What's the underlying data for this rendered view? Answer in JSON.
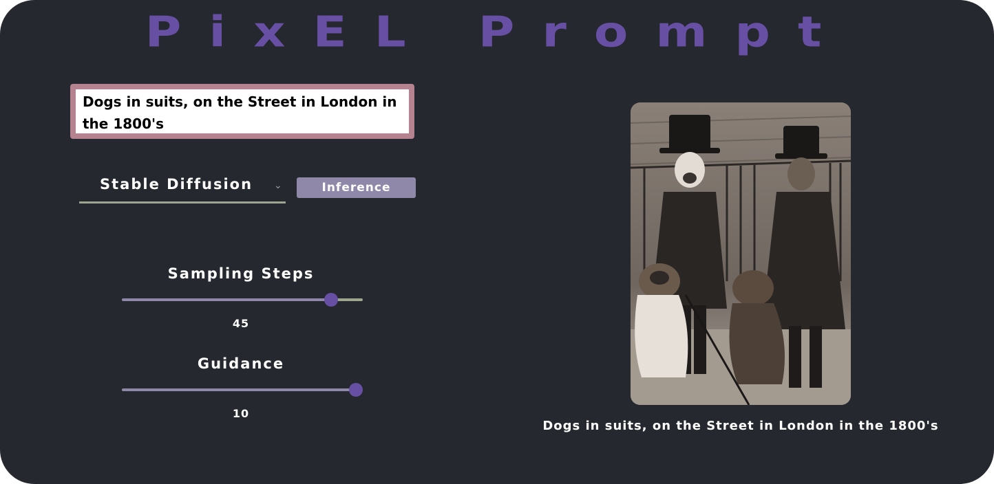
{
  "app": {
    "title": "PixEL Prompt"
  },
  "prompt": {
    "value": "Dogs in suits, on the Street in London in the 1800's"
  },
  "model_select": {
    "selected": "Stable Diffusion"
  },
  "inference_button": {
    "label": "Inference"
  },
  "sliders": {
    "sampling_steps": {
      "label": "Sampling Steps",
      "value": "45"
    },
    "guidance": {
      "label": "Guidance",
      "value": "10"
    }
  },
  "result": {
    "caption": "Dogs in suits, on the Street in London in the 1800's"
  },
  "colors": {
    "background": "#25282e",
    "accent": "#6750a4",
    "prompt_border": "#b5838f",
    "button": "#8f88a8",
    "underline": "#9ea68f"
  }
}
